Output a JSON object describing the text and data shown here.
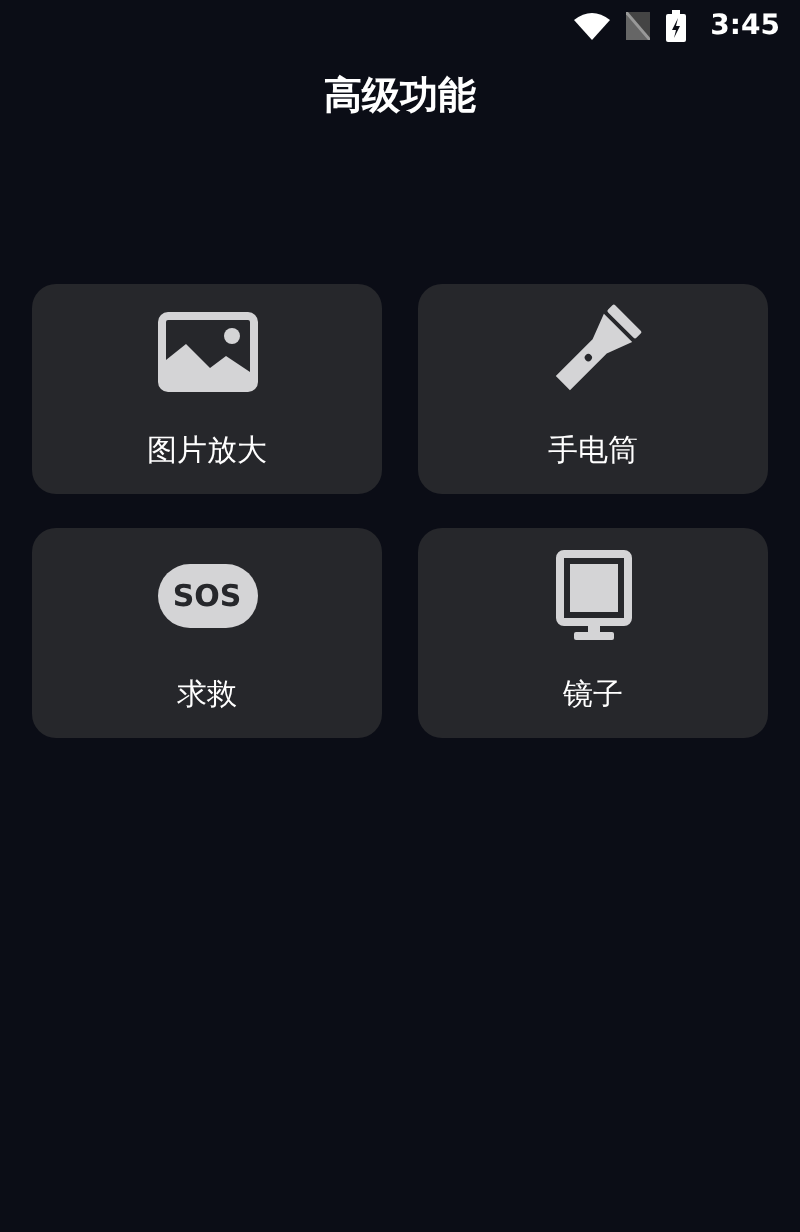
{
  "status_bar": {
    "time": "3:45"
  },
  "title": "高级功能",
  "features": [
    {
      "kind": "image",
      "label": "图片放大"
    },
    {
      "kind": "flashlight",
      "label": "手电筒"
    },
    {
      "kind": "sos",
      "label": "求救",
      "icon_text": "SOS"
    },
    {
      "kind": "mirror",
      "label": "镜子"
    }
  ]
}
